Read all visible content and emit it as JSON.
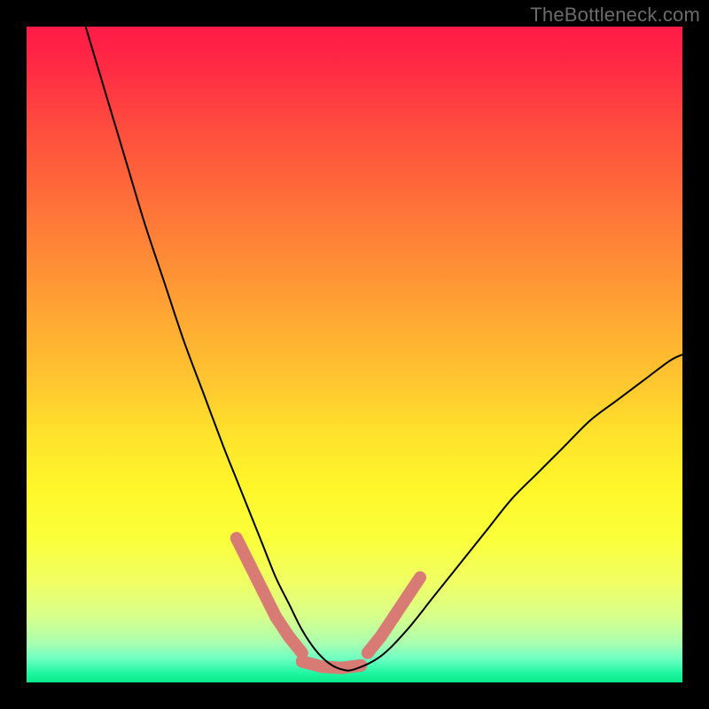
{
  "watermark": "TheBottleneck.com",
  "gradient": {
    "stops": [
      {
        "offset": 0.0,
        "color": "#ff1a47"
      },
      {
        "offset": 0.06,
        "color": "#ff2a44"
      },
      {
        "offset": 0.15,
        "color": "#ff4b3f"
      },
      {
        "offset": 0.25,
        "color": "#ff6a3a"
      },
      {
        "offset": 0.35,
        "color": "#ff8a36"
      },
      {
        "offset": 0.45,
        "color": "#ffaa33"
      },
      {
        "offset": 0.55,
        "color": "#ffc92f"
      },
      {
        "offset": 0.62,
        "color": "#ffe22c"
      },
      {
        "offset": 0.7,
        "color": "#fff62a"
      },
      {
        "offset": 0.78,
        "color": "#fbff3a"
      },
      {
        "offset": 0.85,
        "color": "#efff66"
      },
      {
        "offset": 0.9,
        "color": "#d7ff8b"
      },
      {
        "offset": 0.94,
        "color": "#aaffb0"
      },
      {
        "offset": 0.965,
        "color": "#6affc2"
      },
      {
        "offset": 0.985,
        "color": "#22f7a3"
      },
      {
        "offset": 1.0,
        "color": "#09e989"
      }
    ]
  },
  "chart_data": {
    "type": "line",
    "title": "",
    "xlabel": "",
    "ylabel": "",
    "xlim": [
      0,
      100
    ],
    "ylim": [
      0,
      100
    ],
    "series": [
      {
        "name": "bottleneck-curve",
        "color": "#000000",
        "width": 2,
        "x": [
          9,
          12,
          15,
          18,
          21,
          24,
          27,
          30,
          32,
          34,
          36,
          38,
          40,
          42,
          44,
          46,
          48,
          50,
          54,
          58,
          62,
          66,
          70,
          74,
          78,
          82,
          86,
          90,
          94,
          98,
          100
        ],
        "y": [
          100,
          90,
          80,
          70,
          61,
          52,
          44,
          36,
          31,
          26,
          21,
          16,
          12,
          8,
          5,
          3,
          2,
          2,
          4,
          8,
          13,
          18,
          23,
          28,
          32,
          36,
          40,
          43,
          46,
          49,
          50
        ]
      },
      {
        "name": "good-zone-markers",
        "color": "#d77b74",
        "width": 14,
        "linecap": "round",
        "segments": [
          {
            "x": [
              32,
              34
            ],
            "y": [
              22,
              18
            ]
          },
          {
            "x": [
              34,
              36
            ],
            "y": [
              18,
              14
            ]
          },
          {
            "x": [
              36,
              38
            ],
            "y": [
              14,
              10
            ]
          },
          {
            "x": [
              38,
              40
            ],
            "y": [
              10,
              7
            ]
          },
          {
            "x": [
              40,
              42
            ],
            "y": [
              7,
              4.5
            ]
          },
          {
            "x": [
              42,
              45
            ],
            "y": [
              3.2,
              2.4
            ]
          },
          {
            "x": [
              45,
              48
            ],
            "y": [
              2.4,
              2.2
            ]
          },
          {
            "x": [
              48,
              51
            ],
            "y": [
              2.2,
              2.6
            ]
          },
          {
            "x": [
              52,
              54
            ],
            "y": [
              4.5,
              7
            ]
          },
          {
            "x": [
              54,
              56
            ],
            "y": [
              7,
              10
            ]
          },
          {
            "x": [
              56,
              58
            ],
            "y": [
              10,
              13
            ]
          },
          {
            "x": [
              58,
              60
            ],
            "y": [
              13,
              16
            ]
          }
        ]
      }
    ]
  }
}
